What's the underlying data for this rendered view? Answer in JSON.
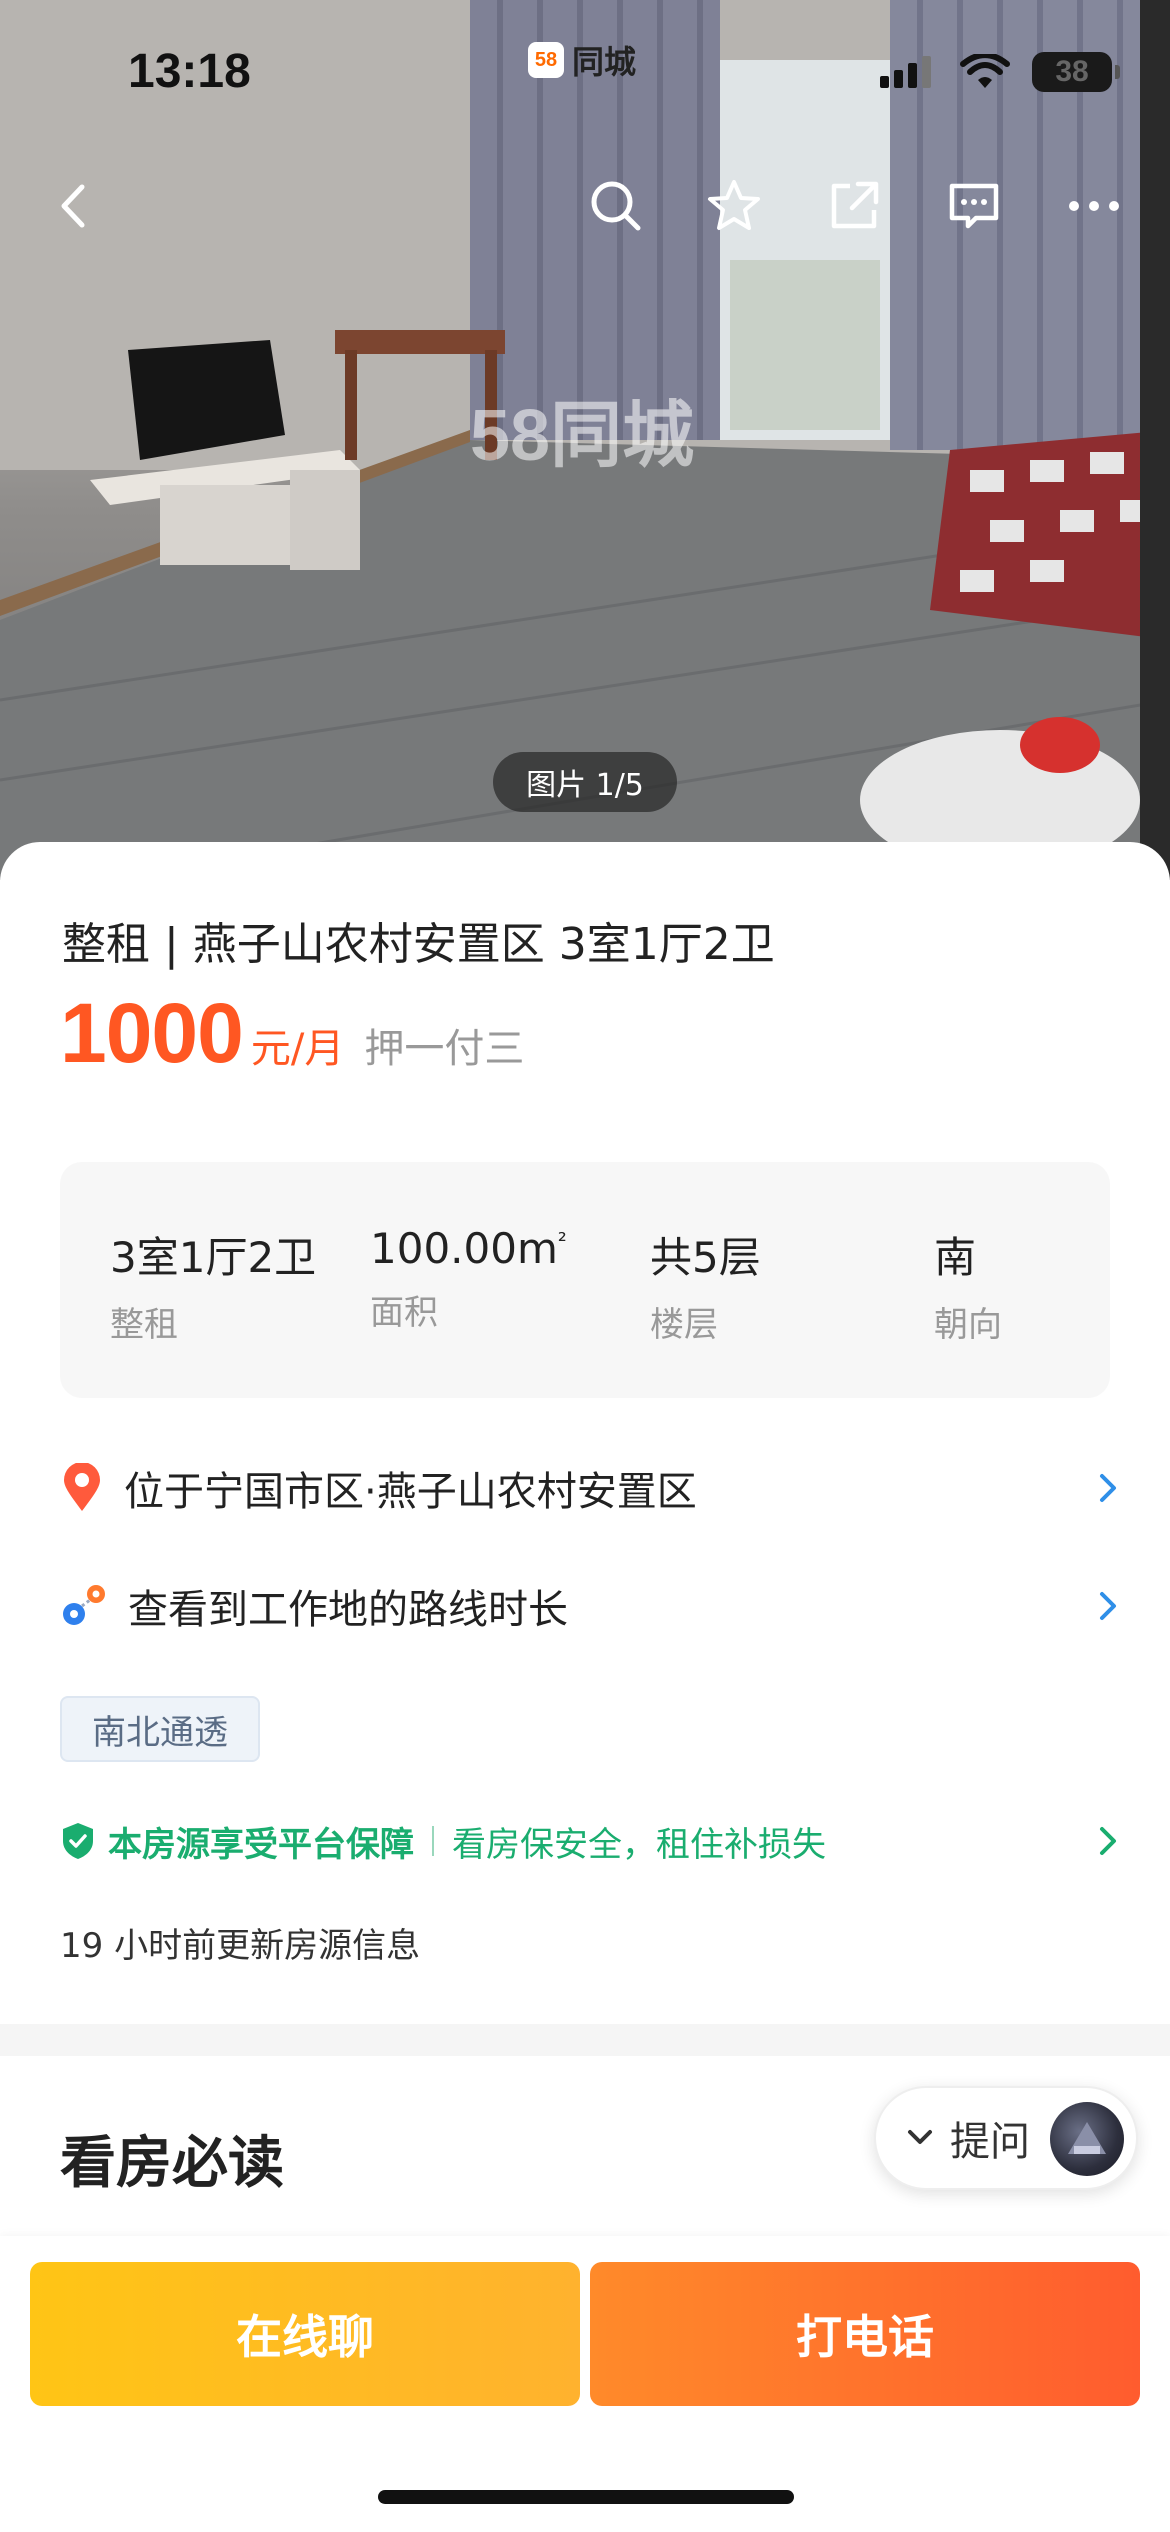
{
  "status_bar": {
    "time": "13:18",
    "app_logo": "58",
    "app_name": "同城",
    "battery": "38"
  },
  "hero": {
    "watermark": "58同城",
    "photo_counter": "图片 1/5"
  },
  "nav": {
    "icons": [
      "back-icon",
      "search-icon",
      "star-icon",
      "share-icon",
      "message-icon",
      "more-icon"
    ]
  },
  "listing": {
    "title": "整租 | 燕子山农村安置区 3室1厅2卫",
    "price": "1000",
    "price_unit": "元/月",
    "payment": "押一付三"
  },
  "facts": [
    {
      "value": "3室1厅2卫",
      "label": "整租"
    },
    {
      "value": "100.00m",
      "unit_sup": "²",
      "label": "面积"
    },
    {
      "value": "共5层",
      "label": "楼层"
    },
    {
      "value": "南",
      "label": "朝向"
    }
  ],
  "location": {
    "text": "位于宁国市区·燕子山农村安置区"
  },
  "commute": {
    "text": "查看到工作地的路线时长"
  },
  "tags": [
    "南北通透"
  ],
  "guarantee": {
    "strong": "本房源享受平台保障",
    "text": "看房保安全，租住补损失"
  },
  "updated": "19 小时前更新房源信息",
  "section": {
    "title": "看房必读"
  },
  "ask": {
    "label": "提问"
  },
  "actions": {
    "chat": "在线聊",
    "call": "打电话"
  },
  "colors": {
    "price": "#ff5722",
    "guarantee": "#1aad6f",
    "chat_button": "#ffc515",
    "call_button": "#ff5c2e"
  }
}
